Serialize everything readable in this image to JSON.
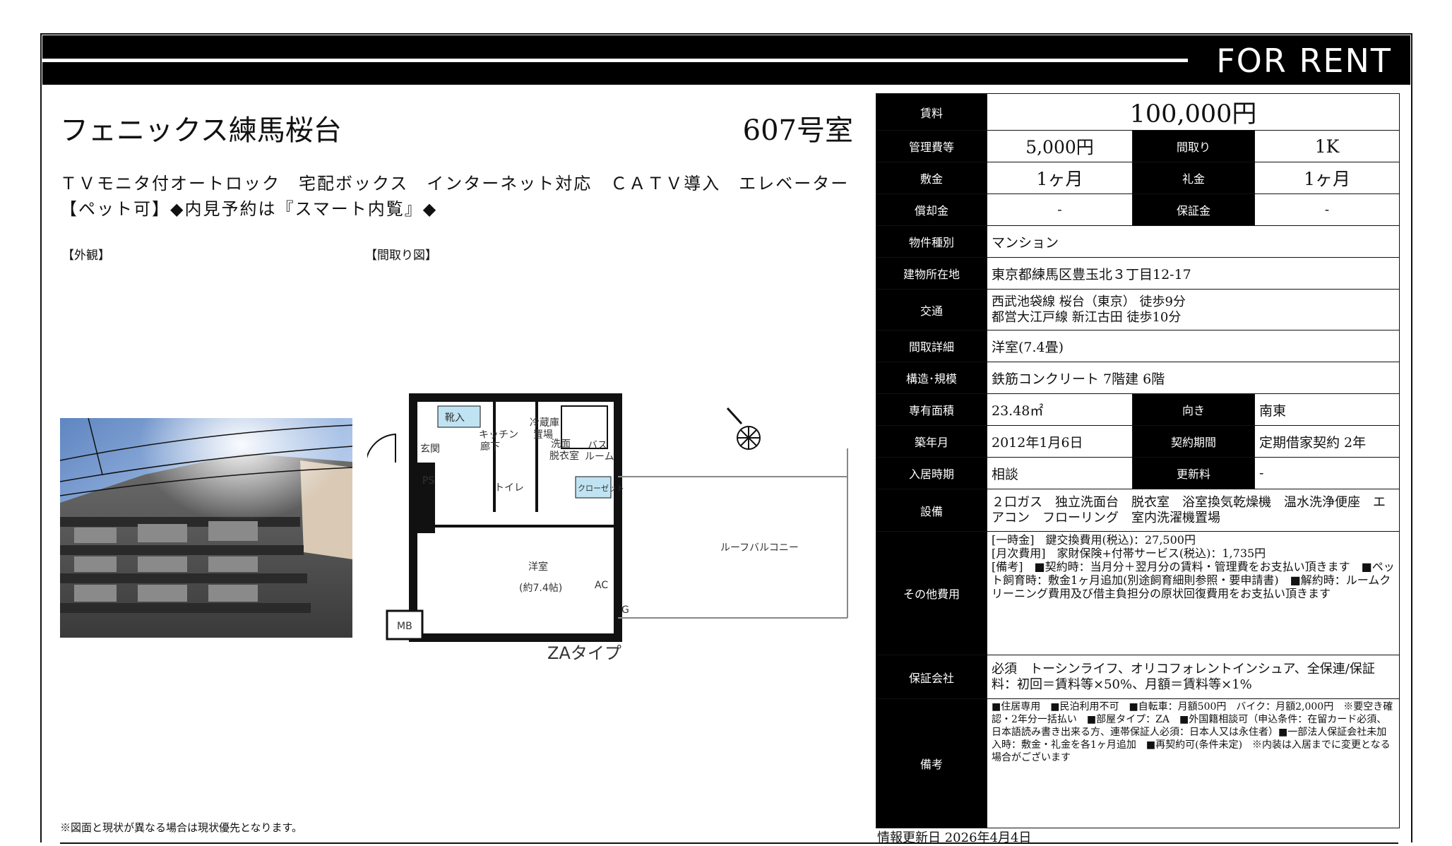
{
  "banner": {
    "text": "FOR RENT"
  },
  "property": {
    "name": "フェニックス練馬桜台",
    "room": "607号室",
    "features_line1": "ＴＶモニタ付オートロック　宅配ボックス　インターネット対応　ＣＡＴＶ導入　エレベーター",
    "features_line2": "【ペット可】◆内見予約は『スマート内覧』◆"
  },
  "images": {
    "exterior_label": "【外観】",
    "floorplan_label": "【間取り図】",
    "floorplan": {
      "type_label": "ZAタイプ",
      "rooms": {
        "entrance": "玄関",
        "kitchen": "キッチン",
        "hall": "廊下",
        "fridge": "冷蔵庫",
        "fridge2": "置場",
        "washroom": "洗面",
        "dressing": "脱衣室",
        "bath": "バス",
        "bath2": "ルーム",
        "toilet": "トイレ",
        "closet": "クローゼット",
        "western": "洋室",
        "western_size": "(約7.4帖)",
        "balcony": "ルーフバルコニー",
        "mb": "MB",
        "ac": "AC",
        "g": "G",
        "shoes": "靴入",
        "ps": "PS"
      }
    }
  },
  "spec": {
    "rent_label": "賃料",
    "rent": "100,000円",
    "mgmt_label": "管理費等",
    "mgmt": "5,000円",
    "layout_label": "間取り",
    "layout": "1K",
    "deposit_label": "敷金",
    "deposit": "1ヶ月",
    "keymoney_label": "礼金",
    "keymoney": "1ヶ月",
    "amort_label": "償却金",
    "amort": "-",
    "guarantee_label": "保証金",
    "guarantee": "-",
    "type_label": "物件種別",
    "type": "マンション",
    "address_label": "建物所在地",
    "address": "東京都練馬区豊玉北３丁目12-17",
    "traffic_label": "交通",
    "traffic1": "西武池袋線 桜台（東京） 徒歩9分",
    "traffic2": "都営大江戸線 新江古田 徒歩10分",
    "layout_detail_label": "間取詳細",
    "layout_detail": "洋室(7.4畳)",
    "structure_label": "構造･規模",
    "structure": "鉄筋コンクリート 7階建 6階",
    "area_label": "専有面積",
    "area": "23.48㎡",
    "direction_label": "向き",
    "direction": "南東",
    "built_label": "築年月",
    "built": "2012年1月6日",
    "contract_label": "契約期間",
    "contract": "定期借家契約 2年",
    "movein_label": "入居時期",
    "movein": "相談",
    "renewal_label": "更新料",
    "renewal": "-",
    "equipment_label": "設備",
    "equipment": "２口ガス　独立洗面台　脱衣室　浴室換気乾燥機　温水洗浄便座　エアコン　フローリング　室内洗濯機置場",
    "other_label": "その他費用",
    "other": "[一時金]　鍵交換費用(税込)：27,500円\n[月次費用]　家財保険+付帯サービス(税込)：1,735円\n[備考]　■契約時：当月分＋翌月分の賃料・管理費をお支払い頂きます　■ペット飼育時：敷金1ヶ月追加(別途飼育細則参照・要申請書)　■解約時：ルームクリーニング費用及び借主負担分の原状回復費用をお支払い頂きます",
    "guarantor_label": "保証会社",
    "guarantor": "必須　トーシンライフ、オリコフォレントインシュア、全保連/保証料：初回＝賃料等×50%、月額＝賃料等×1%",
    "remarks_label": "備考",
    "remarks": "■住居専用　■民泊利用不可　■自転車：月額500円　バイク：月額2,000円　※要空き確認・2年分一括払い　■部屋タイプ：ZA　■外国籍相談可（申込条件：在留カード必須、日本語読み書き出来る方、連帯保証人必須：日本人又は永住者）■一部法人保証会社未加入時：敷金・礼金を各1ヶ月追加　■再契約可(条件未定)　※内装は入居までに変更となる場合がございます"
  },
  "footer": {
    "note": "※図面と現状が異なる場合は現状優先となります。",
    "updated": "情報更新日 2026年4月4日"
  }
}
